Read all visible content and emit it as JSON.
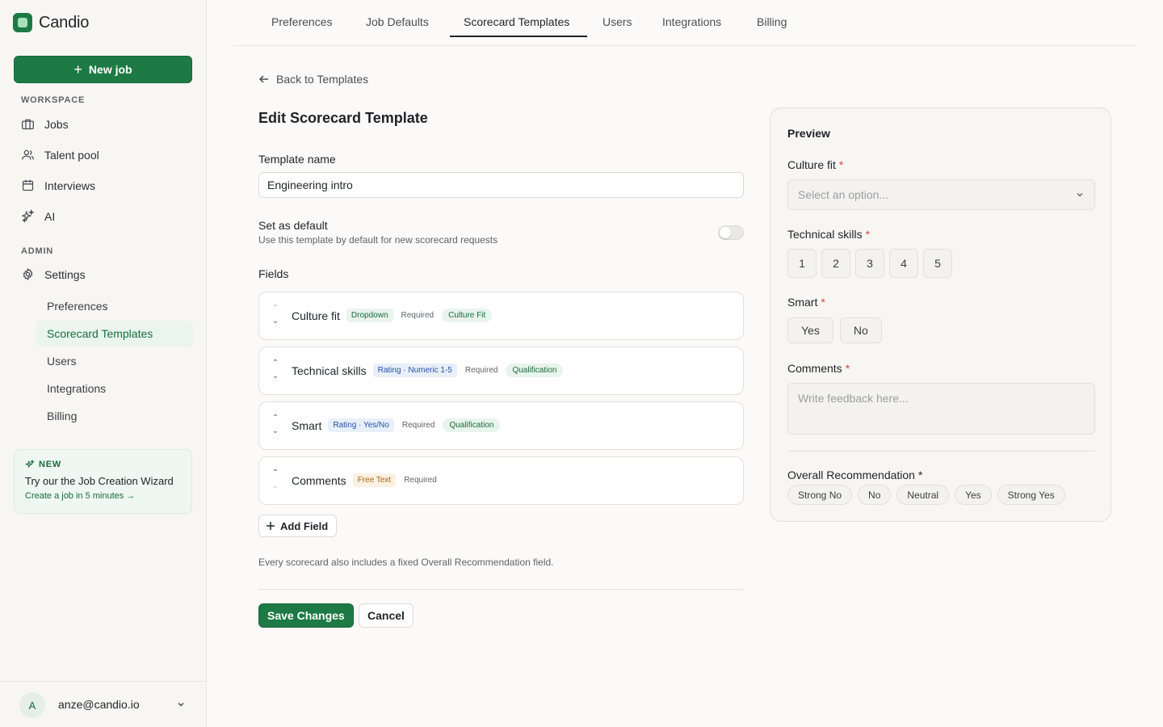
{
  "app": {
    "name": "Candio"
  },
  "sidebar": {
    "new_job_label": "New job",
    "workspace_label": "WORKSPACE",
    "workspace_items": [
      {
        "label": "Jobs",
        "icon": "briefcase-icon"
      },
      {
        "label": "Talent pool",
        "icon": "users-icon"
      },
      {
        "label": "Interviews",
        "icon": "calendar-icon"
      },
      {
        "label": "AI",
        "icon": "sparkles-icon"
      }
    ],
    "admin_label": "ADMIN",
    "settings_label": "Settings",
    "settings_subitems": [
      "Preferences",
      "Scorecard Templates",
      "Users",
      "Integrations",
      "Billing"
    ],
    "active_subitem": "Scorecard Templates",
    "promo": {
      "badge": "NEW",
      "title": "Try our the Job Creation Wizard",
      "subtitle": "Create a job in 5 minutes →"
    },
    "user": {
      "initial": "A",
      "email": "anze@candio.io"
    }
  },
  "tabs": {
    "items": [
      "Preferences",
      "Job Defaults",
      "Scorecard Templates",
      "Users",
      "Integrations",
      "Billing"
    ],
    "active": "Scorecard Templates"
  },
  "form": {
    "back_label": "Back to Templates",
    "title": "Edit Scorecard Template",
    "template_name_label": "Template name",
    "template_name_value": "Engineering intro",
    "default_label": "Set as default",
    "default_hint": "Use this template by default for new scorecard requests",
    "default_on": false,
    "fields_label": "Fields",
    "fields": [
      {
        "name": "Culture fit",
        "type": "Dropdown",
        "type_color": "green",
        "required": "Required",
        "tag": "Culture Fit"
      },
      {
        "name": "Technical skills",
        "type": "Rating · Numeric 1-5",
        "type_color": "blue",
        "required": "Required",
        "tag": "Qualification"
      },
      {
        "name": "Smart",
        "type": "Rating · Yes/No",
        "type_color": "blue",
        "required": "Required",
        "tag": "Qualification"
      },
      {
        "name": "Comments",
        "type": "Free Text",
        "type_color": "orange",
        "required": "Required",
        "tag": ""
      }
    ],
    "add_field_label": "Add Field",
    "footnote": "Every scorecard also includes a fixed Overall Recommendation field.",
    "save_label": "Save Changes",
    "cancel_label": "Cancel"
  },
  "preview": {
    "title": "Preview",
    "culture_fit_label": "Culture fit",
    "culture_fit_placeholder": "Select an option...",
    "technical_label": "Technical skills",
    "ratings": [
      "1",
      "2",
      "3",
      "4",
      "5"
    ],
    "smart_label": "Smart",
    "yesno": [
      "Yes",
      "No"
    ],
    "comments_label": "Comments",
    "comments_placeholder": "Write feedback here...",
    "overall_label": "Overall Recommendation *",
    "recommendations": [
      "Strong No",
      "No",
      "Neutral",
      "Yes",
      "Strong Yes"
    ],
    "required_marker": "*"
  }
}
